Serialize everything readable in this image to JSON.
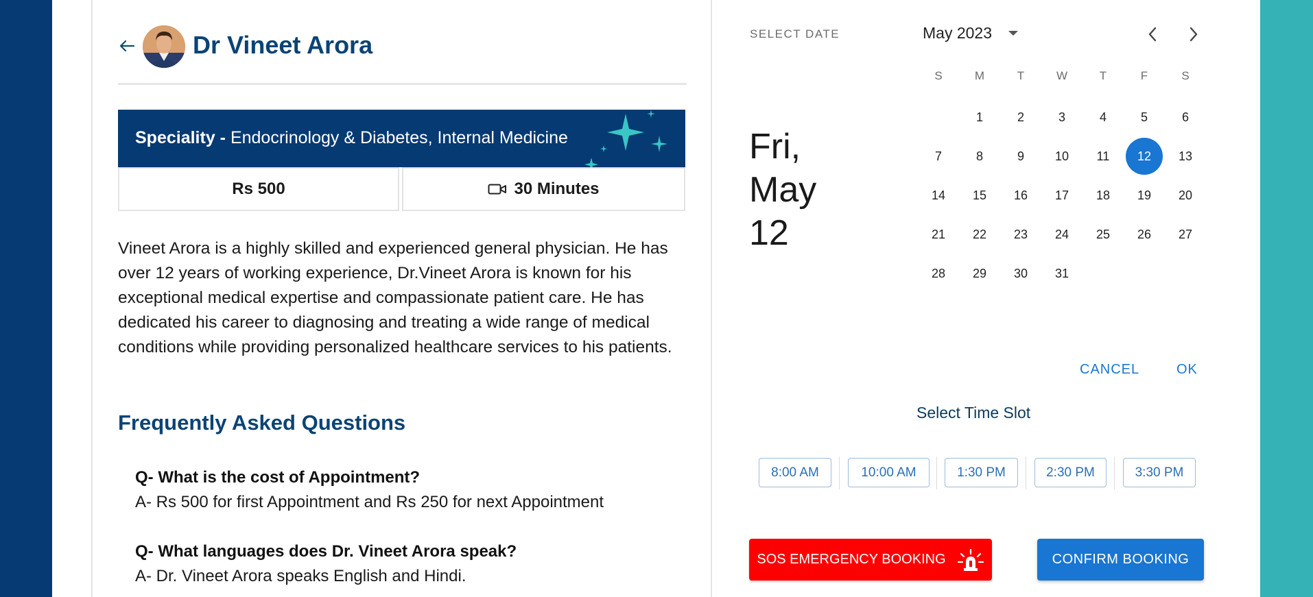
{
  "doctor": {
    "name": "Dr Vineet Arora",
    "speciality_label": "Speciality -",
    "speciality": "Endocrinology & Diabetes, Internal Medicine",
    "fee": "Rs 500",
    "duration": "30 Minutes",
    "bio": "Vineet Arora is a highly skilled and experienced general physician. He has over 12 years of working experience, Dr.Vineet Arora is known for his exceptional medical expertise and compassionate patient care. He has dedicated his career to diagnosing and treating a wide range of medical conditions while providing personalized healthcare services to his patients."
  },
  "icons": {
    "back": "arrow-left-icon",
    "video": "video-camera-icon",
    "prev": "chevron-left-icon",
    "next": "chevron-right-icon",
    "dropdown": "caret-down-icon",
    "siren": "siren-icon"
  },
  "faq": {
    "title": "Frequently Asked Questions",
    "items": [
      {
        "q": "Q- What is the cost of Appointment?",
        "a": "A- Rs 500 for first Appointment and Rs 250 for next Appointment"
      },
      {
        "q": "Q- What languages does Dr. Vineet Arora speak?",
        "a": "A- Dr. Vineet Arora speaks English and Hindi."
      }
    ]
  },
  "datepicker": {
    "label": "SELECT DATE",
    "selected_line1": "Fri,",
    "selected_line2": "May",
    "selected_line3": "12",
    "month_label": "May 2023",
    "weekdays": [
      "S",
      "M",
      "T",
      "W",
      "T",
      "F",
      "S"
    ],
    "first_weekday_index": 1,
    "days_in_month": 31,
    "selected_day": 12,
    "cancel": "CANCEL",
    "ok": "OK"
  },
  "timeslots": {
    "title": "Select Time Slot",
    "slots": [
      "8:00 AM",
      "10:00 AM",
      "1:30 PM",
      "2:30 PM",
      "3:30 PM"
    ]
  },
  "actions": {
    "sos": "SOS EMERGENCY BOOKING",
    "confirm": "CONFIRM BOOKING"
  },
  "colors": {
    "navy": "#063a73",
    "teal": "#35b2b5",
    "primary": "#1976d2",
    "sos": "#ff0000"
  }
}
